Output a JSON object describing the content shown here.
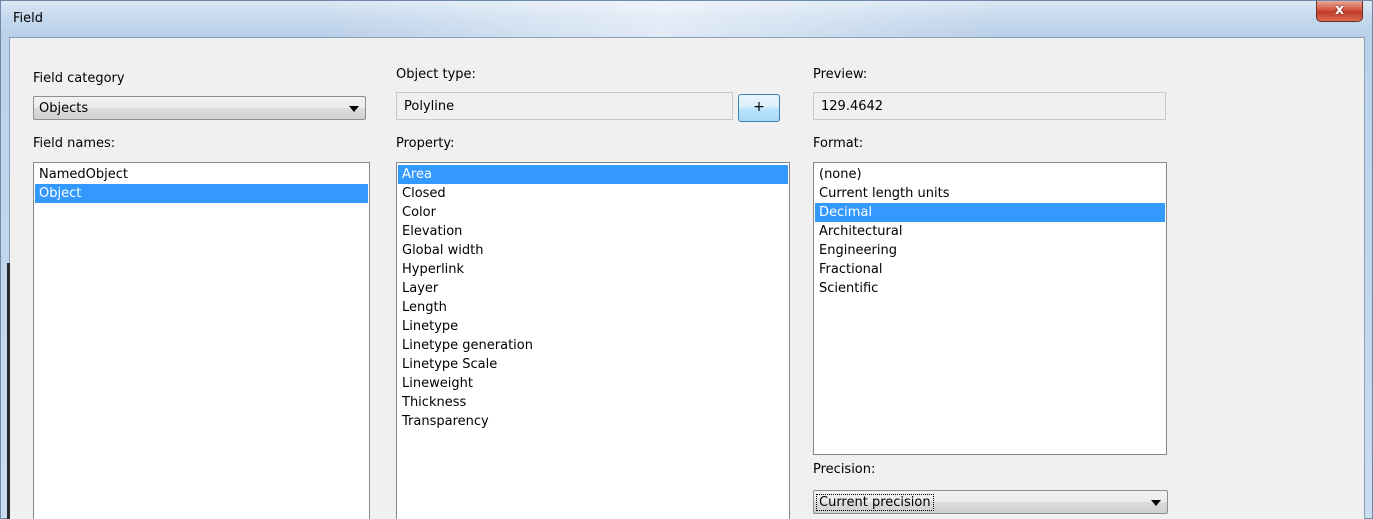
{
  "window": {
    "title": "Field",
    "close_glyph": "x"
  },
  "field_category": {
    "label": "Field category",
    "selected": "Objects"
  },
  "field_names": {
    "label": "Field names:",
    "items": [
      {
        "label": "NamedObject",
        "selected": false
      },
      {
        "label": "Object",
        "selected": true
      }
    ]
  },
  "object_type": {
    "label": "Object type:",
    "value": "Polyline",
    "select_button": "+"
  },
  "property": {
    "label": "Property:",
    "items": [
      {
        "label": "Area",
        "selected": true
      },
      {
        "label": "Closed",
        "selected": false
      },
      {
        "label": "Color",
        "selected": false
      },
      {
        "label": "Elevation",
        "selected": false
      },
      {
        "label": "Global width",
        "selected": false
      },
      {
        "label": "Hyperlink",
        "selected": false
      },
      {
        "label": "Layer",
        "selected": false
      },
      {
        "label": "Length",
        "selected": false
      },
      {
        "label": "Linetype",
        "selected": false
      },
      {
        "label": "Linetype generation",
        "selected": false
      },
      {
        "label": "Linetype Scale",
        "selected": false
      },
      {
        "label": "Lineweight",
        "selected": false
      },
      {
        "label": "Thickness",
        "selected": false
      },
      {
        "label": "Transparency",
        "selected": false
      }
    ]
  },
  "preview": {
    "label": "Preview:",
    "value": "129.4642"
  },
  "format": {
    "label": "Format:",
    "items": [
      {
        "label": "(none)",
        "selected": false
      },
      {
        "label": "Current length units",
        "selected": false
      },
      {
        "label": "Decimal",
        "selected": true
      },
      {
        "label": "Architectural",
        "selected": false
      },
      {
        "label": "Engineering",
        "selected": false
      },
      {
        "label": "Fractional",
        "selected": false
      },
      {
        "label": "Scientific",
        "selected": false
      }
    ]
  },
  "precision": {
    "label": "Precision:",
    "selected": "Current precision"
  },
  "colors": {
    "selection": "#3399ff",
    "dialog_bg": "#f0f0f0",
    "close_button": "#c13d26"
  }
}
